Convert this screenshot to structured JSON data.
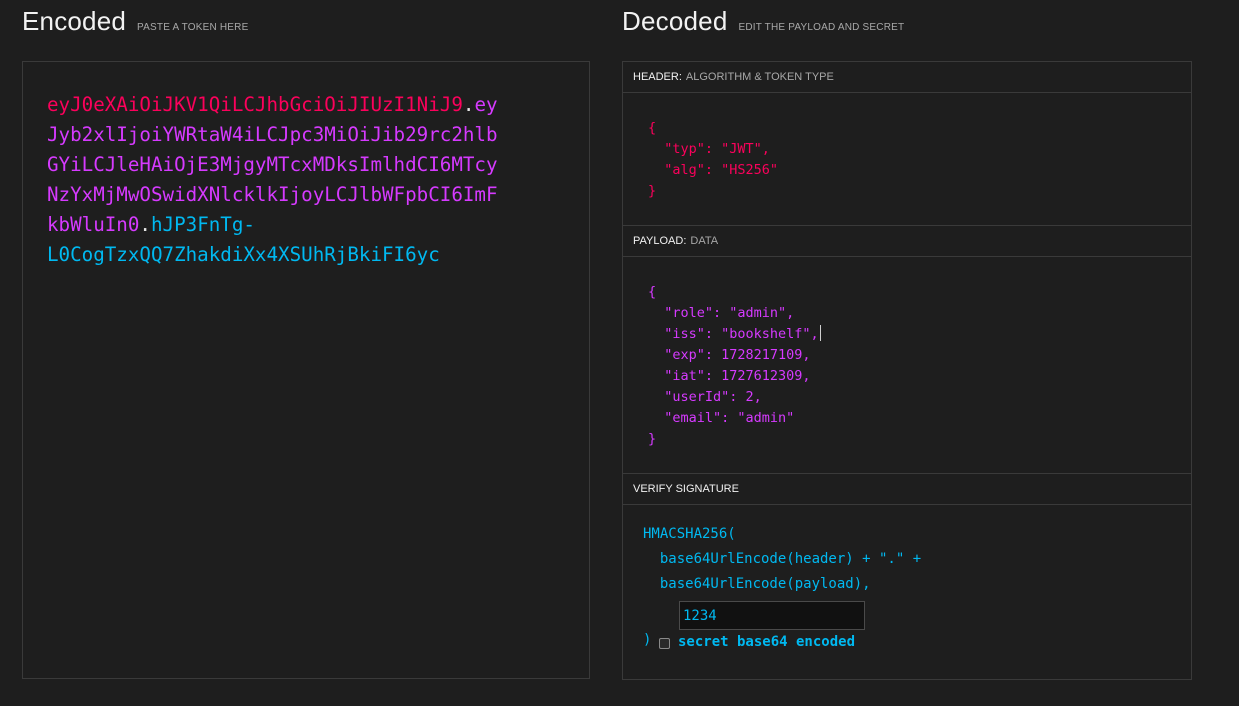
{
  "encoded": {
    "title": "Encoded",
    "subtitle": "PASTE A TOKEN HERE",
    "lines": [
      [
        {
          "part": "header",
          "text": "eyJ0eXAiOiJKV1QiLCJhbGciOiJIUzI1NiJ9"
        },
        {
          "part": "dot",
          "text": "."
        },
        {
          "part": "payload",
          "text": "ey"
        }
      ],
      [
        {
          "part": "payload",
          "text": "Jyb2xlIjoiYWRtaW4iLCJpc3MiOiJib29rc2hlb"
        }
      ],
      [
        {
          "part": "payload",
          "text": "GYiLCJleHAiOjE3MjgyMTcxMDksImlhdCI6MTcy"
        }
      ],
      [
        {
          "part": "payload",
          "text": "NzYxMjMwOSwidXNlcklkIjoyLCJlbWFpbCI6ImF"
        }
      ],
      [
        {
          "part": "payload",
          "text": "kbWluIn0"
        },
        {
          "part": "dot",
          "text": "."
        },
        {
          "part": "signature",
          "text": "hJP3FnTg-"
        }
      ],
      [
        {
          "part": "signature",
          "text": "L0CogTzxQQ7ZhakdiXx4XSUhRjBkiFI6yc"
        }
      ]
    ]
  },
  "decoded": {
    "title": "Decoded",
    "subtitle": "EDIT THE PAYLOAD AND SECRET",
    "header_section": {
      "label": "HEADER:",
      "sublabel": "ALGORITHM & TOKEN TYPE",
      "lines": [
        "{",
        "  \"typ\": \"JWT\",",
        "  \"alg\": \"HS256\"",
        "}"
      ]
    },
    "payload_section": {
      "label": "PAYLOAD:",
      "sublabel": "DATA",
      "lines": [
        "{",
        "  \"role\": \"admin\",",
        "  \"iss\": \"bookshelf\",",
        "  \"exp\": 1728217109,",
        "  \"iat\": 1727612309,",
        "  \"userId\": 2,",
        "  \"email\": \"admin\"",
        "}"
      ]
    },
    "verify_section": {
      "label": "VERIFY SIGNATURE",
      "line1": "HMACSHA256(",
      "line2": "  base64UrlEncode(header) + \".\" +",
      "line3": "  base64UrlEncode(payload),",
      "secret_value": "1234",
      "close_paren": ")",
      "checkbox_label": "secret base64 encoded",
      "checkbox_checked": false
    }
  },
  "colors": {
    "header": "#fb015b",
    "payload": "#d63aff",
    "signature": "#00b9f1",
    "background": "#1e1e1e"
  }
}
